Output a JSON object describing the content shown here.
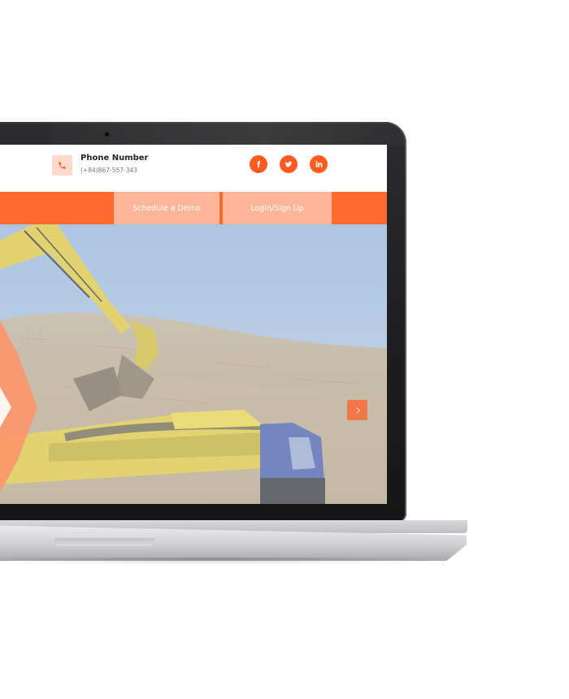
{
  "header": {
    "phone_label": "Phone Number",
    "phone_number": "(+84)867-557-343"
  },
  "social": [
    {
      "name": "facebook",
      "glyph": "f"
    },
    {
      "name": "twitter",
      "glyph": "t"
    },
    {
      "name": "linkedin",
      "glyph": "in"
    }
  ],
  "nav": {
    "schedule_demo": "Schedule a Demo",
    "login_signup": "Login/Sign Up"
  },
  "icons": {
    "phone": "phone-icon",
    "facebook": "facebook-icon",
    "twitter": "twitter-icon",
    "linkedin": "linkedin-icon",
    "next": "chevron-right-icon"
  },
  "colors": {
    "accent": "#ff6a2f",
    "social": "#ff5a1f",
    "button_light": "#ffb597",
    "phone_box": "#ffd9c9"
  }
}
